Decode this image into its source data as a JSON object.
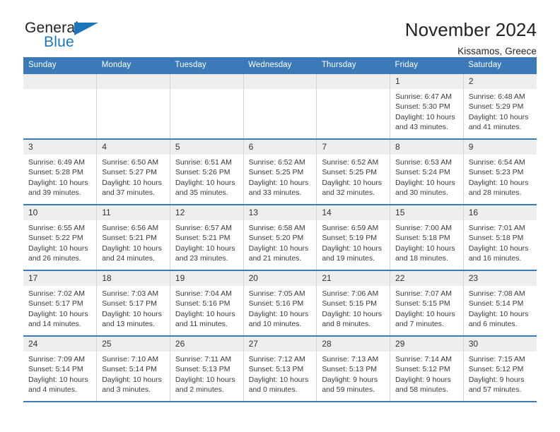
{
  "brand": {
    "name_part1": "General",
    "name_part2": "Blue",
    "triangle_color": "#1b75bb"
  },
  "header": {
    "title": "November 2024",
    "subtitle": "Kissamos, Greece"
  },
  "theme": {
    "header_blue": "#3b79b8",
    "daynum_band": "#eeeeee",
    "grid_line": "#d5d5d5"
  },
  "weekday_headers": [
    "Sunday",
    "Monday",
    "Tuesday",
    "Wednesday",
    "Thursday",
    "Friday",
    "Saturday"
  ],
  "weeks": [
    [
      {
        "day": "",
        "sunrise": "",
        "sunset": "",
        "daylight_line1": "",
        "daylight_line2": ""
      },
      {
        "day": "",
        "sunrise": "",
        "sunset": "",
        "daylight_line1": "",
        "daylight_line2": ""
      },
      {
        "day": "",
        "sunrise": "",
        "sunset": "",
        "daylight_line1": "",
        "daylight_line2": ""
      },
      {
        "day": "",
        "sunrise": "",
        "sunset": "",
        "daylight_line1": "",
        "daylight_line2": ""
      },
      {
        "day": "",
        "sunrise": "",
        "sunset": "",
        "daylight_line1": "",
        "daylight_line2": ""
      },
      {
        "day": "1",
        "sunrise": "Sunrise: 6:47 AM",
        "sunset": "Sunset: 5:30 PM",
        "daylight_line1": "Daylight: 10 hours",
        "daylight_line2": "and 43 minutes."
      },
      {
        "day": "2",
        "sunrise": "Sunrise: 6:48 AM",
        "sunset": "Sunset: 5:29 PM",
        "daylight_line1": "Daylight: 10 hours",
        "daylight_line2": "and 41 minutes."
      }
    ],
    [
      {
        "day": "3",
        "sunrise": "Sunrise: 6:49 AM",
        "sunset": "Sunset: 5:28 PM",
        "daylight_line1": "Daylight: 10 hours",
        "daylight_line2": "and 39 minutes."
      },
      {
        "day": "4",
        "sunrise": "Sunrise: 6:50 AM",
        "sunset": "Sunset: 5:27 PM",
        "daylight_line1": "Daylight: 10 hours",
        "daylight_line2": "and 37 minutes."
      },
      {
        "day": "5",
        "sunrise": "Sunrise: 6:51 AM",
        "sunset": "Sunset: 5:26 PM",
        "daylight_line1": "Daylight: 10 hours",
        "daylight_line2": "and 35 minutes."
      },
      {
        "day": "6",
        "sunrise": "Sunrise: 6:52 AM",
        "sunset": "Sunset: 5:25 PM",
        "daylight_line1": "Daylight: 10 hours",
        "daylight_line2": "and 33 minutes."
      },
      {
        "day": "7",
        "sunrise": "Sunrise: 6:52 AM",
        "sunset": "Sunset: 5:25 PM",
        "daylight_line1": "Daylight: 10 hours",
        "daylight_line2": "and 32 minutes."
      },
      {
        "day": "8",
        "sunrise": "Sunrise: 6:53 AM",
        "sunset": "Sunset: 5:24 PM",
        "daylight_line1": "Daylight: 10 hours",
        "daylight_line2": "and 30 minutes."
      },
      {
        "day": "9",
        "sunrise": "Sunrise: 6:54 AM",
        "sunset": "Sunset: 5:23 PM",
        "daylight_line1": "Daylight: 10 hours",
        "daylight_line2": "and 28 minutes."
      }
    ],
    [
      {
        "day": "10",
        "sunrise": "Sunrise: 6:55 AM",
        "sunset": "Sunset: 5:22 PM",
        "daylight_line1": "Daylight: 10 hours",
        "daylight_line2": "and 26 minutes."
      },
      {
        "day": "11",
        "sunrise": "Sunrise: 6:56 AM",
        "sunset": "Sunset: 5:21 PM",
        "daylight_line1": "Daylight: 10 hours",
        "daylight_line2": "and 24 minutes."
      },
      {
        "day": "12",
        "sunrise": "Sunrise: 6:57 AM",
        "sunset": "Sunset: 5:21 PM",
        "daylight_line1": "Daylight: 10 hours",
        "daylight_line2": "and 23 minutes."
      },
      {
        "day": "13",
        "sunrise": "Sunrise: 6:58 AM",
        "sunset": "Sunset: 5:20 PM",
        "daylight_line1": "Daylight: 10 hours",
        "daylight_line2": "and 21 minutes."
      },
      {
        "day": "14",
        "sunrise": "Sunrise: 6:59 AM",
        "sunset": "Sunset: 5:19 PM",
        "daylight_line1": "Daylight: 10 hours",
        "daylight_line2": "and 19 minutes."
      },
      {
        "day": "15",
        "sunrise": "Sunrise: 7:00 AM",
        "sunset": "Sunset: 5:18 PM",
        "daylight_line1": "Daylight: 10 hours",
        "daylight_line2": "and 18 minutes."
      },
      {
        "day": "16",
        "sunrise": "Sunrise: 7:01 AM",
        "sunset": "Sunset: 5:18 PM",
        "daylight_line1": "Daylight: 10 hours",
        "daylight_line2": "and 16 minutes."
      }
    ],
    [
      {
        "day": "17",
        "sunrise": "Sunrise: 7:02 AM",
        "sunset": "Sunset: 5:17 PM",
        "daylight_line1": "Daylight: 10 hours",
        "daylight_line2": "and 14 minutes."
      },
      {
        "day": "18",
        "sunrise": "Sunrise: 7:03 AM",
        "sunset": "Sunset: 5:17 PM",
        "daylight_line1": "Daylight: 10 hours",
        "daylight_line2": "and 13 minutes."
      },
      {
        "day": "19",
        "sunrise": "Sunrise: 7:04 AM",
        "sunset": "Sunset: 5:16 PM",
        "daylight_line1": "Daylight: 10 hours",
        "daylight_line2": "and 11 minutes."
      },
      {
        "day": "20",
        "sunrise": "Sunrise: 7:05 AM",
        "sunset": "Sunset: 5:16 PM",
        "daylight_line1": "Daylight: 10 hours",
        "daylight_line2": "and 10 minutes."
      },
      {
        "day": "21",
        "sunrise": "Sunrise: 7:06 AM",
        "sunset": "Sunset: 5:15 PM",
        "daylight_line1": "Daylight: 10 hours",
        "daylight_line2": "and 8 minutes."
      },
      {
        "day": "22",
        "sunrise": "Sunrise: 7:07 AM",
        "sunset": "Sunset: 5:15 PM",
        "daylight_line1": "Daylight: 10 hours",
        "daylight_line2": "and 7 minutes."
      },
      {
        "day": "23",
        "sunrise": "Sunrise: 7:08 AM",
        "sunset": "Sunset: 5:14 PM",
        "daylight_line1": "Daylight: 10 hours",
        "daylight_line2": "and 6 minutes."
      }
    ],
    [
      {
        "day": "24",
        "sunrise": "Sunrise: 7:09 AM",
        "sunset": "Sunset: 5:14 PM",
        "daylight_line1": "Daylight: 10 hours",
        "daylight_line2": "and 4 minutes."
      },
      {
        "day": "25",
        "sunrise": "Sunrise: 7:10 AM",
        "sunset": "Sunset: 5:14 PM",
        "daylight_line1": "Daylight: 10 hours",
        "daylight_line2": "and 3 minutes."
      },
      {
        "day": "26",
        "sunrise": "Sunrise: 7:11 AM",
        "sunset": "Sunset: 5:13 PM",
        "daylight_line1": "Daylight: 10 hours",
        "daylight_line2": "and 2 minutes."
      },
      {
        "day": "27",
        "sunrise": "Sunrise: 7:12 AM",
        "sunset": "Sunset: 5:13 PM",
        "daylight_line1": "Daylight: 10 hours",
        "daylight_line2": "and 0 minutes."
      },
      {
        "day": "28",
        "sunrise": "Sunrise: 7:13 AM",
        "sunset": "Sunset: 5:13 PM",
        "daylight_line1": "Daylight: 9 hours",
        "daylight_line2": "and 59 minutes."
      },
      {
        "day": "29",
        "sunrise": "Sunrise: 7:14 AM",
        "sunset": "Sunset: 5:12 PM",
        "daylight_line1": "Daylight: 9 hours",
        "daylight_line2": "and 58 minutes."
      },
      {
        "day": "30",
        "sunrise": "Sunrise: 7:15 AM",
        "sunset": "Sunset: 5:12 PM",
        "daylight_line1": "Daylight: 9 hours",
        "daylight_line2": "and 57 minutes."
      }
    ]
  ]
}
